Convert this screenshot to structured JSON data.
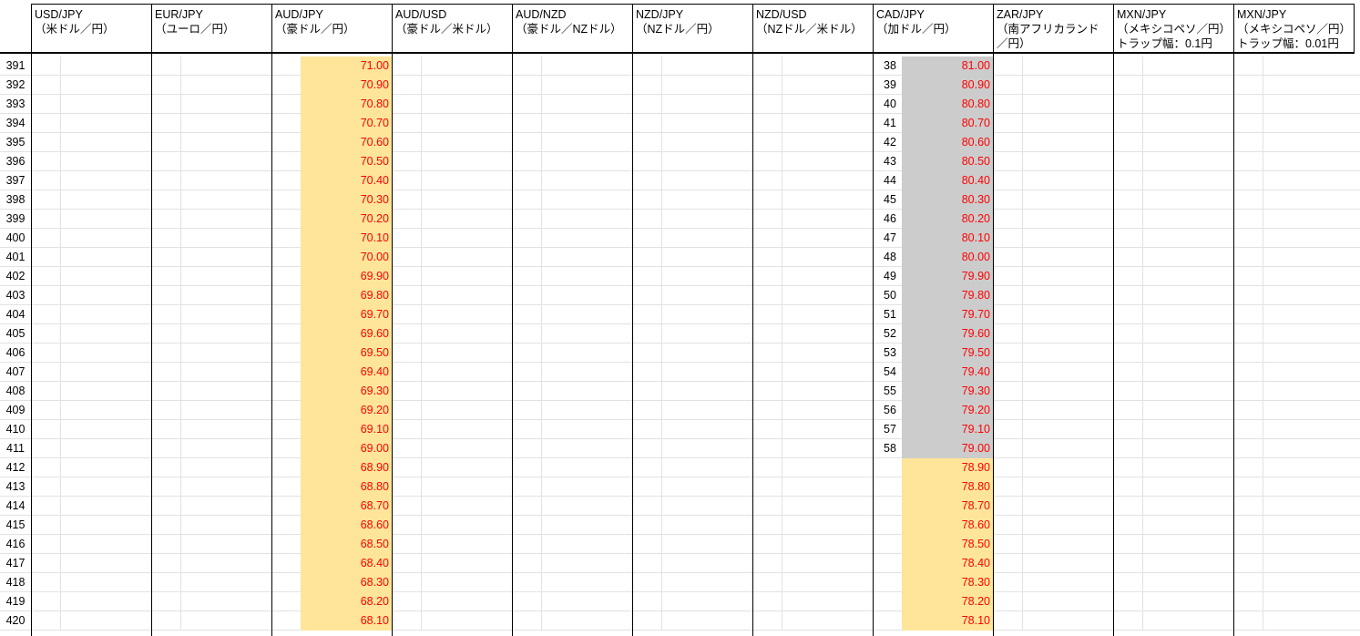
{
  "colors": {
    "aud_fill": "#ffe599",
    "cad_fill_held": "#cccccc",
    "cad_fill_pending": "#ffe599",
    "price_text": "#ff0000",
    "grid": "#e2e2e2",
    "border": "#000000"
  },
  "headers": [
    {
      "pair": "USD/JPY",
      "name": "（米ドル／円）",
      "extra": ""
    },
    {
      "pair": "EUR/JPY",
      "name": "（ユーロ／円）",
      "extra": ""
    },
    {
      "pair": "AUD/JPY",
      "name": "（豪ドル／円）",
      "extra": ""
    },
    {
      "pair": "AUD/USD",
      "name": "（豪ドル／米ドル）",
      "extra": ""
    },
    {
      "pair": "AUD/NZD",
      "name": "（豪ドル／NZドル）",
      "extra": ""
    },
    {
      "pair": "NZD/JPY",
      "name": "（NZドル／円）",
      "extra": ""
    },
    {
      "pair": "NZD/USD",
      "name": "（NZドル／米ドル）",
      "extra": ""
    },
    {
      "pair": "CAD/JPY",
      "name": "（加ドル／円）",
      "extra": ""
    },
    {
      "pair": "ZAR/JPY",
      "name": "（南アフリカランド",
      "extra": "／円）"
    },
    {
      "pair": "MXN/JPY",
      "name": "（メキシコペソ／円）",
      "extra": "トラップ幅：0.1円"
    },
    {
      "pair": "MXN/JPY",
      "name": "（メキシコペソ／円）",
      "extra": "トラップ幅：0.01円"
    }
  ],
  "rows": [
    {
      "row": "391",
      "aud": "71.00",
      "cad_count": "38",
      "cad": "81.00",
      "cad_state": "held"
    },
    {
      "row": "392",
      "aud": "70.90",
      "cad_count": "39",
      "cad": "80.90",
      "cad_state": "held"
    },
    {
      "row": "393",
      "aud": "70.80",
      "cad_count": "40",
      "cad": "80.80",
      "cad_state": "held"
    },
    {
      "row": "394",
      "aud": "70.70",
      "cad_count": "41",
      "cad": "80.70",
      "cad_state": "held"
    },
    {
      "row": "395",
      "aud": "70.60",
      "cad_count": "42",
      "cad": "80.60",
      "cad_state": "held"
    },
    {
      "row": "396",
      "aud": "70.50",
      "cad_count": "43",
      "cad": "80.50",
      "cad_state": "held"
    },
    {
      "row": "397",
      "aud": "70.40",
      "cad_count": "44",
      "cad": "80.40",
      "cad_state": "held"
    },
    {
      "row": "398",
      "aud": "70.30",
      "cad_count": "45",
      "cad": "80.30",
      "cad_state": "held"
    },
    {
      "row": "399",
      "aud": "70.20",
      "cad_count": "46",
      "cad": "80.20",
      "cad_state": "held"
    },
    {
      "row": "400",
      "aud": "70.10",
      "cad_count": "47",
      "cad": "80.10",
      "cad_state": "held"
    },
    {
      "row": "401",
      "aud": "70.00",
      "cad_count": "48",
      "cad": "80.00",
      "cad_state": "held"
    },
    {
      "row": "402",
      "aud": "69.90",
      "cad_count": "49",
      "cad": "79.90",
      "cad_state": "held"
    },
    {
      "row": "403",
      "aud": "69.80",
      "cad_count": "50",
      "cad": "79.80",
      "cad_state": "held"
    },
    {
      "row": "404",
      "aud": "69.70",
      "cad_count": "51",
      "cad": "79.70",
      "cad_state": "held"
    },
    {
      "row": "405",
      "aud": "69.60",
      "cad_count": "52",
      "cad": "79.60",
      "cad_state": "held"
    },
    {
      "row": "406",
      "aud": "69.50",
      "cad_count": "53",
      "cad": "79.50",
      "cad_state": "held"
    },
    {
      "row": "407",
      "aud": "69.40",
      "cad_count": "54",
      "cad": "79.40",
      "cad_state": "held"
    },
    {
      "row": "408",
      "aud": "69.30",
      "cad_count": "55",
      "cad": "79.30",
      "cad_state": "held"
    },
    {
      "row": "409",
      "aud": "69.20",
      "cad_count": "56",
      "cad": "79.20",
      "cad_state": "held"
    },
    {
      "row": "410",
      "aud": "69.10",
      "cad_count": "57",
      "cad": "79.10",
      "cad_state": "held"
    },
    {
      "row": "411",
      "aud": "69.00",
      "cad_count": "58",
      "cad": "79.00",
      "cad_state": "held"
    },
    {
      "row": "412",
      "aud": "68.90",
      "cad_count": "",
      "cad": "78.90",
      "cad_state": "pending"
    },
    {
      "row": "413",
      "aud": "68.80",
      "cad_count": "",
      "cad": "78.80",
      "cad_state": "pending"
    },
    {
      "row": "414",
      "aud": "68.70",
      "cad_count": "",
      "cad": "78.70",
      "cad_state": "pending"
    },
    {
      "row": "415",
      "aud": "68.60",
      "cad_count": "",
      "cad": "78.60",
      "cad_state": "pending"
    },
    {
      "row": "416",
      "aud": "68.50",
      "cad_count": "",
      "cad": "78.50",
      "cad_state": "pending"
    },
    {
      "row": "417",
      "aud": "68.40",
      "cad_count": "",
      "cad": "78.40",
      "cad_state": "pending"
    },
    {
      "row": "418",
      "aud": "68.30",
      "cad_count": "",
      "cad": "78.30",
      "cad_state": "pending"
    },
    {
      "row": "419",
      "aud": "68.20",
      "cad_count": "",
      "cad": "78.20",
      "cad_state": "pending"
    },
    {
      "row": "420",
      "aud": "68.10",
      "cad_count": "",
      "cad": "78.10",
      "cad_state": "pending"
    }
  ]
}
